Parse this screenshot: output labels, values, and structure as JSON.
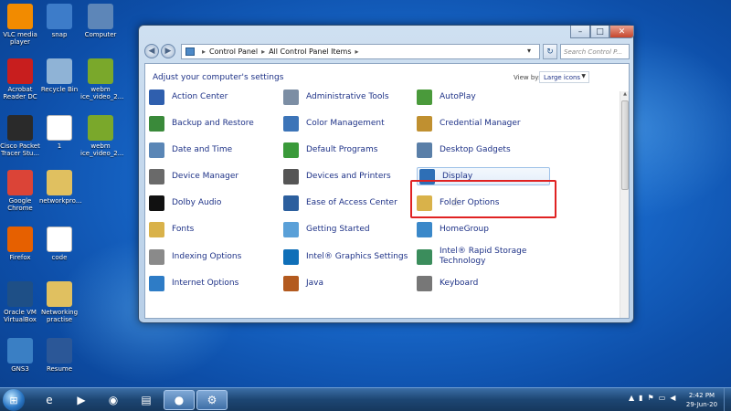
{
  "desktop": {
    "icons": [
      {
        "label": "VLC media player",
        "icon": "vlc-icon",
        "color": "#f28b00"
      },
      {
        "label": "snap",
        "icon": "snap-folder-icon",
        "color": "#3d7cc9"
      },
      {
        "label": "Computer",
        "icon": "computer-icon",
        "color": "#5d86b8"
      },
      {
        "label": "Acrobat Reader DC",
        "icon": "acrobat-icon",
        "color": "#c81e1e"
      },
      {
        "label": "Recycle Bin",
        "icon": "recycle-bin-icon",
        "color": "#8fb3d6"
      },
      {
        "label": "webm ice_video_2...",
        "icon": "webm-icon",
        "color": "#7aa82b"
      },
      {
        "label": "Cisco Packet Tracer Stu...",
        "icon": "cisco-icon",
        "color": "#2a2a2a"
      },
      {
        "label": "1",
        "icon": "document-icon",
        "color": "#ffffff"
      },
      {
        "label": "webm ice_video_2...",
        "icon": "webm-icon",
        "color": "#7aa82b"
      },
      {
        "label": "Google Chrome",
        "icon": "chrome-icon",
        "color": "#db4437"
      },
      {
        "label": "networkpro...",
        "icon": "folder-icon",
        "color": "#e0c060"
      },
      {
        "label": "Firefox",
        "icon": "firefox-icon",
        "color": "#e66000"
      },
      {
        "label": "code",
        "icon": "document-icon",
        "color": "#ffffff"
      },
      {
        "label": "Oracle VM VirtualBox",
        "icon": "virtualbox-icon",
        "color": "#1e4f86"
      },
      {
        "label": "Networking practise",
        "icon": "folder-icon",
        "color": "#e0c060"
      },
      {
        "label": "GNS3",
        "icon": "gns3-icon",
        "color": "#3a7fc4"
      },
      {
        "label": "Resume",
        "icon": "word-doc-icon",
        "color": "#2b5797"
      }
    ]
  },
  "window": {
    "breadcrumb": [
      "Control Panel",
      "All Control Panel Items"
    ],
    "search_placeholder": "Search Control P...",
    "heading": "Adjust your computer's settings",
    "view_by_label": "View by:",
    "view_by_value": "Large icons",
    "items": [
      {
        "label": "Action Center",
        "icon": "flag-icon",
        "color": "#2f5fae"
      },
      {
        "label": "Administrative Tools",
        "icon": "admin-tools-icon",
        "color": "#7c8ea4"
      },
      {
        "label": "AutoPlay",
        "icon": "autoplay-icon",
        "color": "#4a9a3b"
      },
      {
        "label": "Backup and Restore",
        "icon": "backup-icon",
        "color": "#3a8a3a"
      },
      {
        "label": "Color Management",
        "icon": "color-management-icon",
        "color": "#3c74b8"
      },
      {
        "label": "Credential Manager",
        "icon": "credential-icon",
        "color": "#c09030"
      },
      {
        "label": "Date and Time",
        "icon": "clock-icon",
        "color": "#5a86b6"
      },
      {
        "label": "Default Programs",
        "icon": "default-programs-icon",
        "color": "#3a9a3a"
      },
      {
        "label": "Desktop Gadgets",
        "icon": "gadgets-icon",
        "color": "#5a7fa8"
      },
      {
        "label": "Device Manager",
        "icon": "device-manager-icon",
        "color": "#6a6a6a"
      },
      {
        "label": "Devices and Printers",
        "icon": "printer-icon",
        "color": "#555555"
      },
      {
        "label": "Display",
        "icon": "display-icon",
        "color": "#2e6fb6"
      },
      {
        "label": "Dolby Audio",
        "icon": "dolby-icon",
        "color": "#111111"
      },
      {
        "label": "Ease of Access Center",
        "icon": "ease-of-access-icon",
        "color": "#2c5f9e"
      },
      {
        "label": "Folder Options",
        "icon": "folder-options-icon",
        "color": "#d9b24a"
      },
      {
        "label": "Fonts",
        "icon": "fonts-icon",
        "color": "#d9b24a"
      },
      {
        "label": "Getting Started",
        "icon": "getting-started-icon",
        "color": "#5aa0d8"
      },
      {
        "label": "HomeGroup",
        "icon": "homegroup-icon",
        "color": "#3a88c9"
      },
      {
        "label": "Indexing Options",
        "icon": "indexing-icon",
        "color": "#8a8a8a"
      },
      {
        "label": "Intel® Graphics Settings",
        "icon": "intel-graphics-icon",
        "color": "#0f6fb8"
      },
      {
        "label": "Intel® Rapid Storage Technology",
        "icon": "intel-storage-icon",
        "color": "#3b8d5c"
      },
      {
        "label": "Internet Options",
        "icon": "internet-options-icon",
        "color": "#2e7cc6"
      },
      {
        "label": "Java",
        "icon": "java-icon",
        "color": "#b35a1f"
      },
      {
        "label": "Keyboard",
        "icon": "keyboard-icon",
        "color": "#777777"
      }
    ]
  },
  "taskbar": {
    "buttons": [
      {
        "icon": "internet-explorer-icon",
        "glyph": "e"
      },
      {
        "icon": "media-player-icon",
        "glyph": "▶"
      },
      {
        "icon": "chrome-icon",
        "glyph": "◉"
      },
      {
        "icon": "file-explorer-icon",
        "glyph": "▤"
      },
      {
        "icon": "recorder-icon",
        "glyph": "●"
      },
      {
        "icon": "control-panel-icon",
        "glyph": "⚙"
      }
    ],
    "time": "2:42 PM",
    "date": "29-Jun-20"
  }
}
